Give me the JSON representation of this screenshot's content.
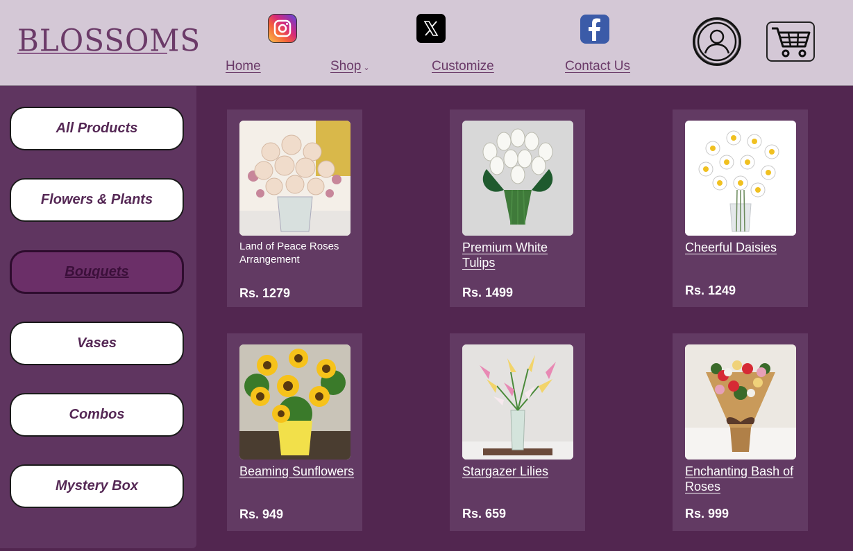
{
  "header": {
    "logo": "BLOSSOMS",
    "nav": [
      {
        "label": "Home"
      },
      {
        "label": "Shop"
      },
      {
        "label": "Customize"
      },
      {
        "label": "Contact Us"
      }
    ],
    "social_icons": [
      "instagram-icon",
      "x-icon",
      "facebook-icon"
    ],
    "account_icon": "user-icon",
    "cart_icon": "cart-icon"
  },
  "sidebar": {
    "categories": [
      {
        "label": "All Products"
      },
      {
        "label": "Flowers & Plants"
      },
      {
        "label": "Bouquets",
        "active": true
      },
      {
        "label": "Vases"
      },
      {
        "label": "Combos"
      },
      {
        "label": "Mystery Box"
      }
    ]
  },
  "products": [
    {
      "name": "Land of Peace Roses Arrangement",
      "price": "Rs. 1279"
    },
    {
      "name": "Premium White Tulips",
      "price": "Rs. 1499"
    },
    {
      "name": "Cheerful Daisies",
      "price": "Rs. 1249"
    },
    {
      "name": "Beaming Sunflowers",
      "price": "Rs. 949"
    },
    {
      "name": "Stargazer Lilies",
      "price": "Rs. 659"
    },
    {
      "name": "Enchanting Bash of Roses",
      "price": "Rs. 999"
    }
  ],
  "colors": {
    "page_bg": "#522650",
    "header_bg": "#d4c8d6",
    "sidebar_bg": "#5f3560",
    "card_bg": "#623a63",
    "accent": "#6b2f68"
  }
}
